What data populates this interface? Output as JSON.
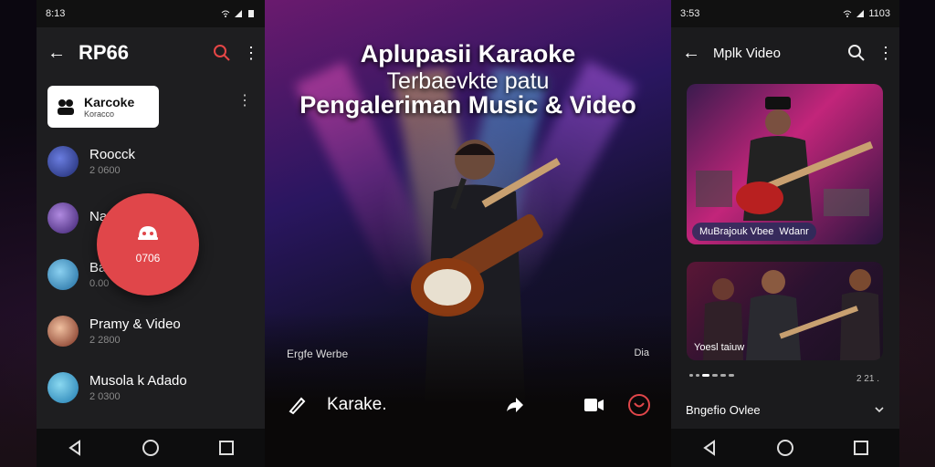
{
  "left_phone": {
    "status": {
      "time": "8:13"
    },
    "appbar": {
      "title": "RP66"
    },
    "chip": {
      "title": "Karcoke",
      "subtitle": "Koracco"
    },
    "items": [
      {
        "name": "Roocck",
        "sub": "2 0600",
        "color": "#2a3e8f"
      },
      {
        "name": "Na",
        "sub": "",
        "color": "#4a2a88"
      },
      {
        "name": "Ba",
        "sub": "0.00",
        "color": "#2c8ac2"
      },
      {
        "name": "Pramy & Video",
        "sub": "2 2800",
        "color": "#b64a3a"
      },
      {
        "name": "Musola k Adado",
        "sub": "2 0300",
        "color": "#3a90c9"
      }
    ],
    "fab": {
      "label": "0706"
    }
  },
  "hero": {
    "title": "Aplupasii Karaoke",
    "subtitle": "Terbaevkte patu",
    "title2": "Pengaleriman Music & Video",
    "caption_left": "Ergfe Werbe",
    "caption_right": "Dia",
    "controls": {
      "label": "Karake."
    }
  },
  "right_phone": {
    "status": {
      "time": "3:53",
      "battery": "1103"
    },
    "appbar": {
      "title": "Mplk Video"
    },
    "card1": {
      "tag_left": "MuBrajouk Vbee",
      "tag_right": "Wdanr"
    },
    "card2": {
      "tag": "Yoesl taiuw"
    },
    "page": "2 21 .",
    "dropdown": {
      "label": "Bngefio Ovlee"
    }
  },
  "colors": {
    "accent": "#e0464a",
    "search": "#e64646"
  }
}
